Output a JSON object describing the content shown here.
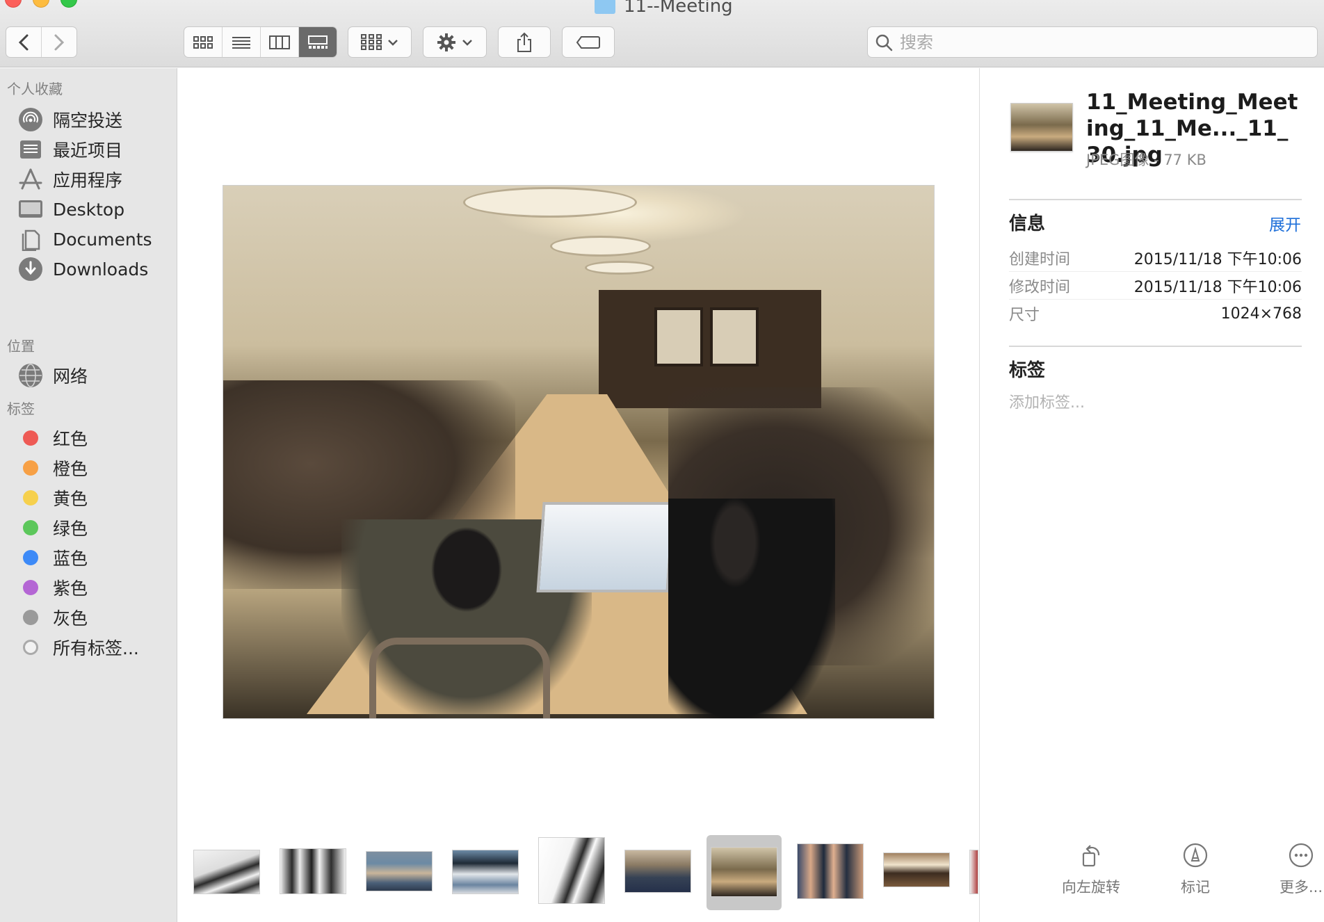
{
  "window": {
    "title": "11--Meeting"
  },
  "search": {
    "placeholder": "搜索"
  },
  "sidebar": {
    "favorites_title": "个人收藏",
    "favorites": [
      {
        "label": "隔空投送",
        "icon": "airdrop-icon"
      },
      {
        "label": "最近项目",
        "icon": "recents-icon"
      },
      {
        "label": "应用程序",
        "icon": "applications-icon"
      },
      {
        "label": "Desktop",
        "icon": "desktop-icon"
      },
      {
        "label": "Documents",
        "icon": "documents-icon"
      },
      {
        "label": "Downloads",
        "icon": "downloads-icon"
      }
    ],
    "locations_title": "位置",
    "locations": [
      {
        "label": "网络",
        "icon": "network-icon"
      }
    ],
    "tags_title": "标签",
    "tags": [
      {
        "label": "红色",
        "color": "#ee5a55"
      },
      {
        "label": "橙色",
        "color": "#f7a045"
      },
      {
        "label": "黄色",
        "color": "#f6d04d"
      },
      {
        "label": "绿色",
        "color": "#5cc75b"
      },
      {
        "label": "蓝色",
        "color": "#3d8af7"
      },
      {
        "label": "紫色",
        "color": "#b466d4"
      },
      {
        "label": "灰色",
        "color": "#9a9a9a"
      },
      {
        "label": "所有标签...",
        "color": "none"
      }
    ]
  },
  "inspector": {
    "filename": "11_Meeting_Meeting_11_Me..._11_30.jpg",
    "kind": "JPEG图像 - 77 KB",
    "info_title": "信息",
    "expand_label": "展开",
    "info": [
      {
        "key": "创建时间",
        "value": "2015/11/18 下午10:06"
      },
      {
        "key": "修改时间",
        "value": "2015/11/18 下午10:06"
      },
      {
        "key": "尺寸",
        "value": "1024×768"
      }
    ],
    "tags_title": "标签",
    "tags_placeholder": "添加标签...",
    "quick_actions": [
      {
        "label": "向左旋转",
        "icon": "rotate-left-icon"
      },
      {
        "label": "标记",
        "icon": "markup-icon"
      },
      {
        "label": "更多...",
        "icon": "more-icon"
      }
    ]
  },
  "filmstrip": {
    "count": 10,
    "selected_index": 6
  }
}
